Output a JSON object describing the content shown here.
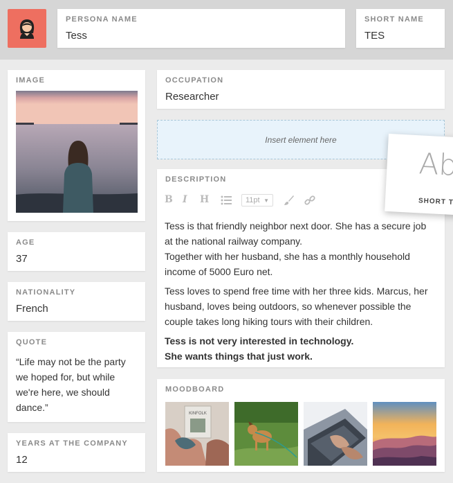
{
  "header": {
    "persona_name": {
      "label": "PERSONA NAME",
      "value": "Tess"
    },
    "short_name": {
      "label": "SHORT NAME",
      "value": "TES"
    },
    "avatar_icon": "persona-avatar-icon",
    "avatar_color": "#ee6f60"
  },
  "image": {
    "label": "IMAGE"
  },
  "occupation": {
    "label": "OCCUPATION",
    "value": "Researcher"
  },
  "insert": {
    "text": "Insert element here"
  },
  "description": {
    "label": "DESCRIPTION",
    "toolbar": {
      "bold": "B",
      "italic": "I",
      "heading": "H",
      "font_size": "11pt"
    },
    "paragraphs": [
      "Tess is that friendly neighbor next door. She has a secure job at the national railway company.",
      "Together with her husband, she has a monthly household income of 5000 Euro net.",
      "Tess loves to spend free time with her three kids. Marcus, her husband, loves being outdoors, so whenever possible the couple takes long hiking tours with their children."
    ],
    "bold_paragraphs": [
      "Tess is not very interested in technology.",
      "She wants things that just work."
    ]
  },
  "age": {
    "label": "AGE",
    "value": "37"
  },
  "nationality": {
    "label": "NATIONALITY",
    "value": "French"
  },
  "quote": {
    "label": "QUOTE",
    "value": "“Life may not be the party we hoped for, but while we're here, we should dance.”"
  },
  "years": {
    "label": "YEARS AT THE COMPANY",
    "value": "12"
  },
  "moodboard": {
    "label": "MOODBOARD",
    "book_text": "KINFOLK"
  },
  "drag_element": {
    "preview": "Ab",
    "label": "SHORT TEXT"
  }
}
